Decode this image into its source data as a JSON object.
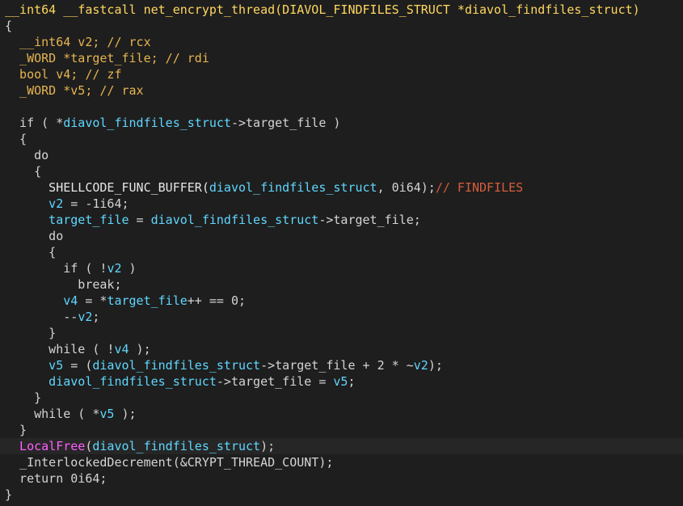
{
  "code_lines": [
    {
      "segments": [
        {
          "t": "__int64 __fastcall net_encrypt_thread(DIAVOL_FINDFILES_STRUCT *diavol_findfiles_struct)",
          "c": "sig"
        }
      ]
    },
    {
      "segments": [
        {
          "t": "{",
          "c": "plain"
        }
      ]
    },
    {
      "segments": [
        {
          "t": "  __int64 v2; // rcx",
          "c": "type"
        }
      ]
    },
    {
      "segments": [
        {
          "t": "  _WORD *target_file; // rdi",
          "c": "type"
        }
      ]
    },
    {
      "segments": [
        {
          "t": "  bool v4; // zf",
          "c": "type"
        }
      ]
    },
    {
      "segments": [
        {
          "t": "  _WORD *v5; // rax",
          "c": "type"
        }
      ]
    },
    {
      "segments": [
        {
          "t": "",
          "c": "plain"
        }
      ]
    },
    {
      "segments": [
        {
          "t": "  if ( *",
          "c": "plain"
        },
        {
          "t": "diavol_findfiles_struct",
          "c": "var"
        },
        {
          "t": "->target_file )",
          "c": "plain"
        }
      ]
    },
    {
      "segments": [
        {
          "t": "  {",
          "c": "plain"
        }
      ]
    },
    {
      "segments": [
        {
          "t": "    do",
          "c": "plain"
        }
      ]
    },
    {
      "segments": [
        {
          "t": "    {",
          "c": "plain"
        }
      ]
    },
    {
      "segments": [
        {
          "t": "      SHELLCODE_FUNC_BUFFER(",
          "c": "func-name"
        },
        {
          "t": "diavol_findfiles_struct",
          "c": "var"
        },
        {
          "t": ", 0i64);",
          "c": "plain"
        },
        {
          "t": "// FINDFILES",
          "c": "comment"
        }
      ]
    },
    {
      "segments": [
        {
          "t": "      v2",
          "c": "var"
        },
        {
          "t": " = -1i64;",
          "c": "plain"
        }
      ]
    },
    {
      "segments": [
        {
          "t": "      target_file",
          "c": "var"
        },
        {
          "t": " = ",
          "c": "plain"
        },
        {
          "t": "diavol_findfiles_struct",
          "c": "var"
        },
        {
          "t": "->target_file;",
          "c": "plain"
        }
      ]
    },
    {
      "segments": [
        {
          "t": "      do",
          "c": "plain"
        }
      ]
    },
    {
      "segments": [
        {
          "t": "      {",
          "c": "plain"
        }
      ]
    },
    {
      "segments": [
        {
          "t": "        if ( !",
          "c": "plain"
        },
        {
          "t": "v2",
          "c": "var"
        },
        {
          "t": " )",
          "c": "plain"
        }
      ]
    },
    {
      "segments": [
        {
          "t": "          break;",
          "c": "plain"
        }
      ]
    },
    {
      "segments": [
        {
          "t": "        v4",
          "c": "var"
        },
        {
          "t": " = *",
          "c": "plain"
        },
        {
          "t": "target_file",
          "c": "var"
        },
        {
          "t": "++ == 0;",
          "c": "plain"
        }
      ]
    },
    {
      "segments": [
        {
          "t": "        --",
          "c": "plain"
        },
        {
          "t": "v2",
          "c": "var"
        },
        {
          "t": ";",
          "c": "plain"
        }
      ]
    },
    {
      "segments": [
        {
          "t": "      }",
          "c": "plain"
        }
      ]
    },
    {
      "segments": [
        {
          "t": "      while ( !",
          "c": "plain"
        },
        {
          "t": "v4",
          "c": "var"
        },
        {
          "t": " );",
          "c": "plain"
        }
      ]
    },
    {
      "segments": [
        {
          "t": "      v5",
          "c": "var"
        },
        {
          "t": " = (",
          "c": "plain"
        },
        {
          "t": "diavol_findfiles_struct",
          "c": "var"
        },
        {
          "t": "->target_file + 2 * ~",
          "c": "plain"
        },
        {
          "t": "v2",
          "c": "var"
        },
        {
          "t": ");",
          "c": "plain"
        }
      ]
    },
    {
      "segments": [
        {
          "t": "      diavol_findfiles_struct",
          "c": "var"
        },
        {
          "t": "->target_file = ",
          "c": "plain"
        },
        {
          "t": "v5",
          "c": "var"
        },
        {
          "t": ";",
          "c": "plain"
        }
      ]
    },
    {
      "segments": [
        {
          "t": "    }",
          "c": "plain"
        }
      ]
    },
    {
      "segments": [
        {
          "t": "    while ( *",
          "c": "plain"
        },
        {
          "t": "v5",
          "c": "var"
        },
        {
          "t": " );",
          "c": "plain"
        }
      ]
    },
    {
      "segments": [
        {
          "t": "  }",
          "c": "plain"
        }
      ]
    },
    {
      "segments": [
        {
          "t": "  LocalFree",
          "c": "import-call"
        },
        {
          "t": "(",
          "c": "plain"
        },
        {
          "t": "diavol_findfiles_struct",
          "c": "var"
        },
        {
          "t": ");",
          "c": "plain"
        }
      ],
      "highlighted": true
    },
    {
      "segments": [
        {
          "t": "  _InterlockedDecrement(&CRYPT_THREAD_COUNT);",
          "c": "plain"
        }
      ]
    },
    {
      "segments": [
        {
          "t": "  return 0i64;",
          "c": "plain"
        }
      ]
    },
    {
      "segments": [
        {
          "t": "}",
          "c": "plain"
        }
      ]
    }
  ],
  "colors": {
    "background": "#1e1e1e",
    "signature": "#ffd75f",
    "declaration": "#e6b450",
    "variable": "#5fd7ff",
    "comment": "#d65d3a",
    "import_call": "#ff5fff",
    "plain": "#d4d4d4",
    "highlight_line": "#262626"
  }
}
